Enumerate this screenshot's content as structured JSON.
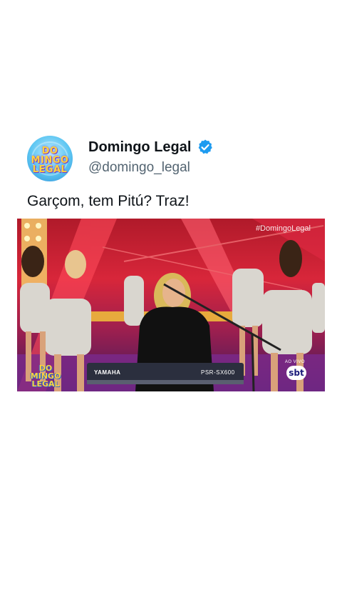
{
  "tweet": {
    "avatar_text": "DO MINGO LEGAL",
    "display_name": "Domingo Legal",
    "verified": "verified-badge-icon",
    "handle": "@domingo_legal",
    "text": "Garçom, tem Pitú? Traz!"
  },
  "media": {
    "hashtag": "#DomingoLegal",
    "live_label": "AO VIVO",
    "channel_logo": "sbt",
    "show_logo": "DO MINGO LEGAL",
    "keyboard_brand": "YAMAHA",
    "keyboard_model": "PSR-SX600"
  },
  "colors": {
    "verified_blue": "#1d9bf0",
    "stage_red": "#d8263a",
    "stage_purple": "#3e1a5e"
  }
}
